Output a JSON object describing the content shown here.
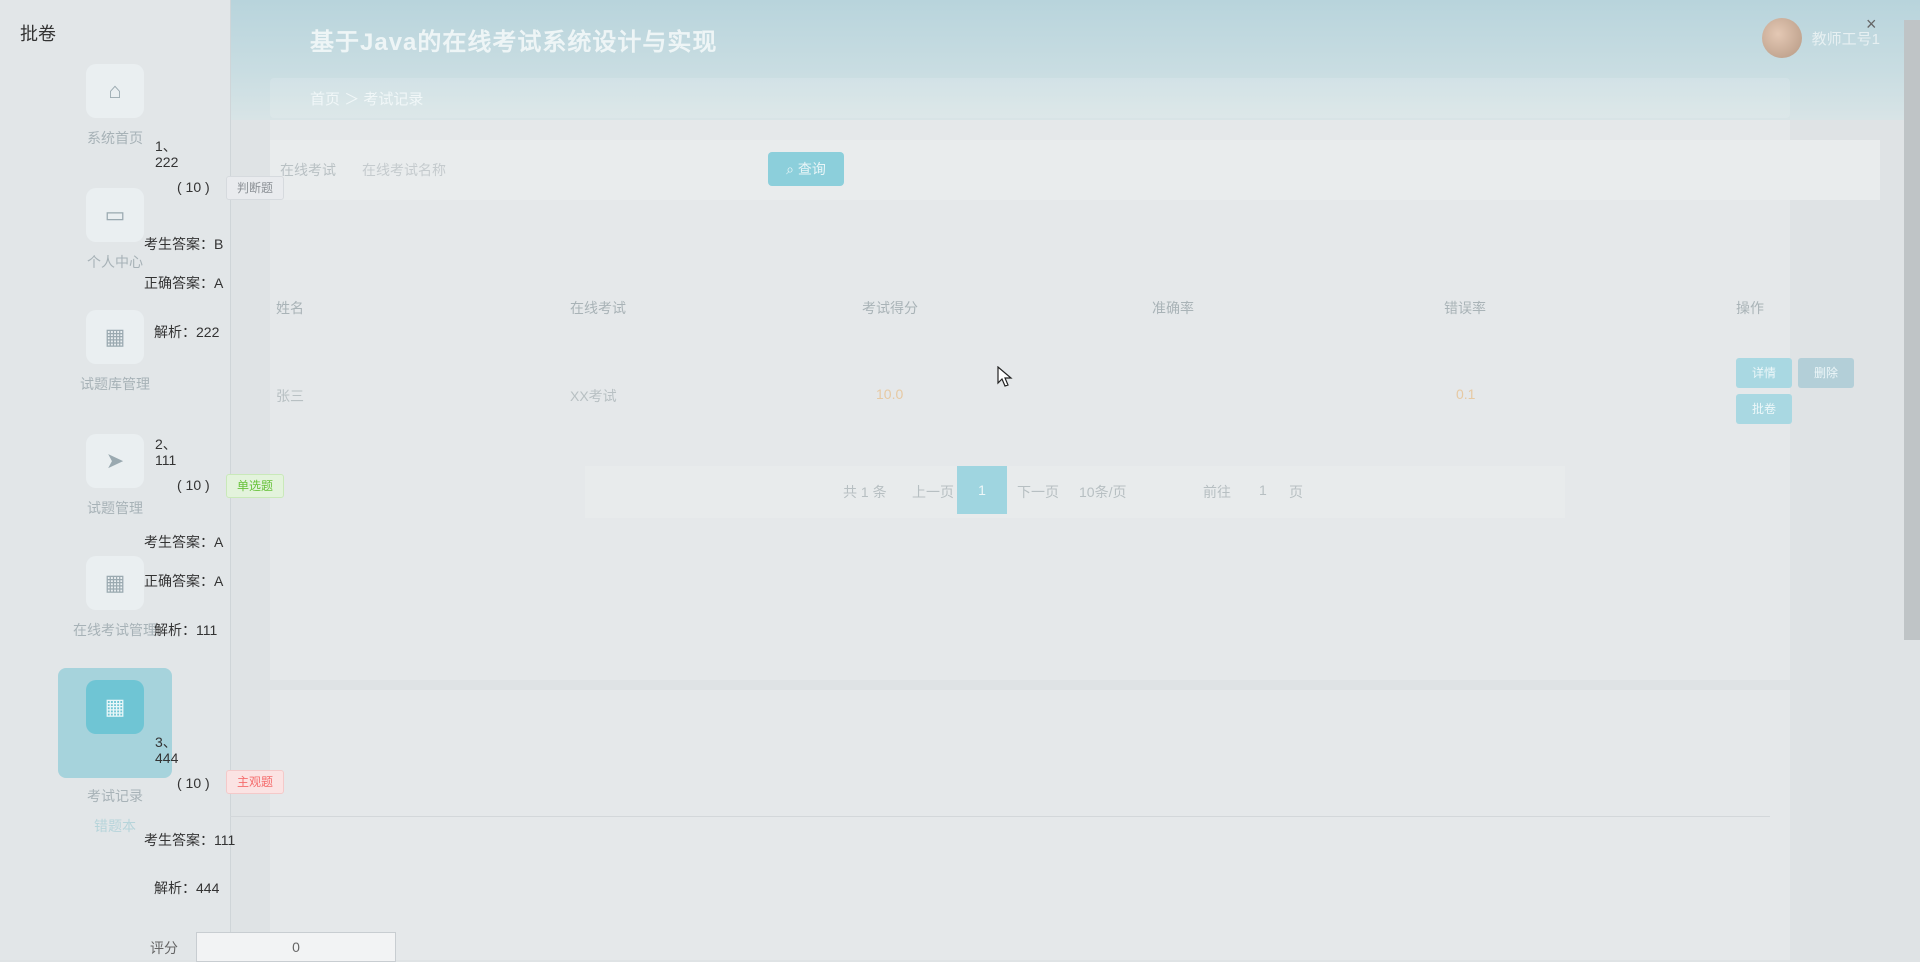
{
  "app": {
    "title": "基于Java的在线考试系统设计与实现",
    "user": "教师工号1",
    "breadcrumb": [
      "首页",
      "考试记录"
    ]
  },
  "sidebar": {
    "items": [
      {
        "label": "系统首页",
        "icon": "home-icon"
      },
      {
        "label": "个人中心",
        "icon": "card-icon"
      },
      {
        "label": "试题库管理",
        "icon": "grid-icon"
      },
      {
        "label": "试题管理",
        "icon": "send-icon"
      },
      {
        "label": "在线考试管理",
        "icon": "grid-icon"
      },
      {
        "label": "考试记录",
        "icon": "grid-icon"
      },
      {
        "label": "错题本",
        "icon": "grid-icon"
      }
    ]
  },
  "search": {
    "label": "在线考试",
    "placeholder": "在线考试名称",
    "button": "查询"
  },
  "table": {
    "headers": [
      "姓名",
      "在线考试",
      "考试得分",
      "准确率",
      "错误率",
      "操作"
    ],
    "row": [
      "张三",
      "XX考试",
      "10.0",
      "",
      "0.1"
    ],
    "ops": [
      "详情",
      "删除",
      "批卷"
    ]
  },
  "pager": {
    "total": "共 1 条",
    "prev": "上一页",
    "current": "1",
    "next": "下一页",
    "size": "10条/页",
    "goto": "前往",
    "page": "1",
    "unit": "页"
  },
  "dialog": {
    "title": "批卷",
    "close": "×",
    "questions": [
      {
        "num": "1、",
        "text": "222",
        "score": "( 10 )",
        "tag": "判断题",
        "student_label": "考生答案：",
        "student": "B",
        "correct_label": "正确答案：",
        "correct": "A",
        "analysis_label": "解析：",
        "analysis": "222"
      },
      {
        "num": "2、",
        "text": "111",
        "score": "( 10 )",
        "tag": "单选题",
        "student_label": "考生答案：",
        "student": "A",
        "correct_label": "正确答案：",
        "correct": "A",
        "analysis_label": "解析：",
        "analysis": "111"
      },
      {
        "num": "3、",
        "text": "444",
        "score": "( 10 )",
        "tag": "主观题",
        "student_label": "考生答案：",
        "student": "111",
        "analysis_label": "解析：",
        "analysis": "444"
      }
    ],
    "score_label": "评分",
    "score_value": "0"
  }
}
